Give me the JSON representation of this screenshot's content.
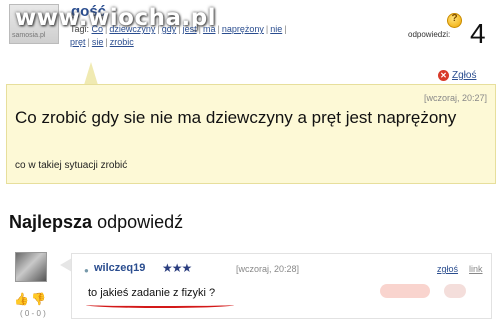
{
  "watermark": "www.wiocha.pl",
  "question": {
    "user": "gość",
    "avatar_label": "samosia.pl",
    "tags_label": "Tagi:",
    "tags": [
      "Co",
      "dziewczyny",
      "gdy",
      "jest",
      "ma",
      "naprężony",
      "nie",
      "pręt",
      "sie",
      "zrobic"
    ],
    "answers_label": "odpowiedzi:",
    "answers_count": "4",
    "report_label": "Zgłoś",
    "time": "[wczoraj, 20:27]",
    "title": "Co zrobić gdy sie nie ma dziewczyny a pręt jest naprężony",
    "body": "co w takiej sytuacji zrobić"
  },
  "best_answer": {
    "heading_bold": "Najlepsza",
    "heading_rest": "odpowiedź",
    "user": "wilczeq19",
    "rating_stars": 3,
    "time": "[wczoraj, 20:28]",
    "report_label": "zgłoś",
    "link_label": "link",
    "text": "to jakieś zadanie z fizyki ?",
    "votes": "( 0 - 0 )"
  },
  "colors": {
    "link": "#2a4d8f",
    "question_bg": "#fdf9d6",
    "underline": "#d31919"
  }
}
